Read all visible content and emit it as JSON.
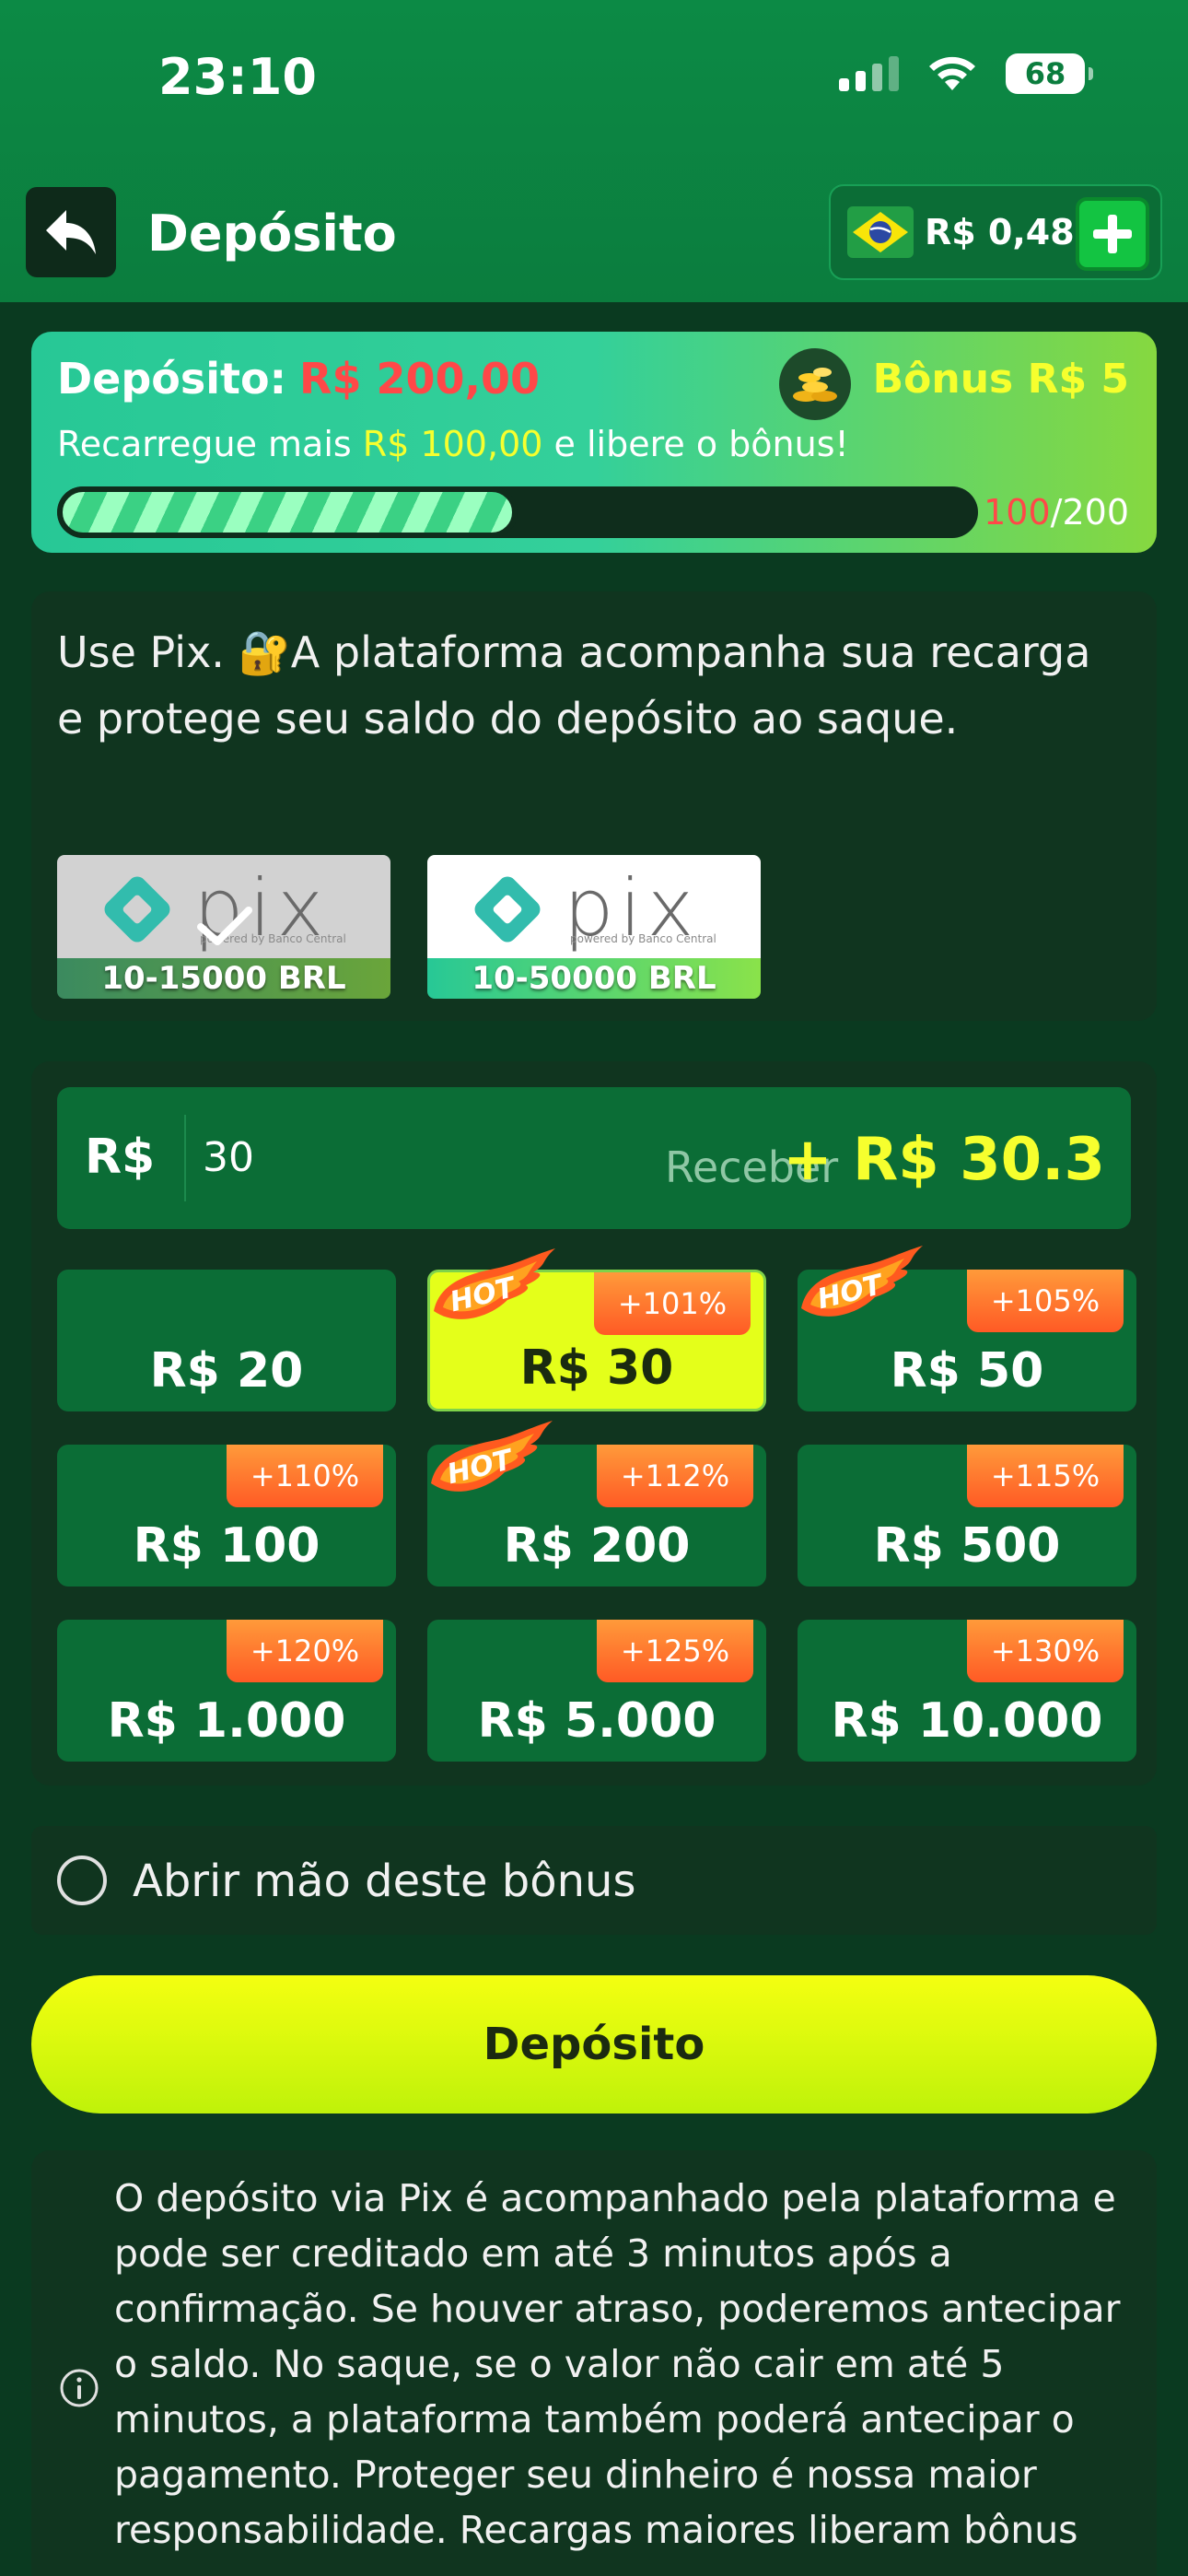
{
  "status_bar": {
    "time": "23:10",
    "battery": "68"
  },
  "header": {
    "title": "Depósito",
    "balance": "R$ 0,48"
  },
  "bonus_card": {
    "deposit_label": "Depósito:",
    "deposit_value": "R$ 200,00",
    "bonus": "Bônus R$ 5",
    "hint_prefix": "Recarregue mais",
    "hint_amount": "R$ 100,00",
    "hint_suffix": "e libere o bônus!",
    "progress_current": "100",
    "progress_total": "/200",
    "progress_fraction": 0.5
  },
  "pix_panel": {
    "text": "Use Pix. 🔐A plataforma acompanha sua recarga e protege seu saldo do depósito ao saque.",
    "options": [
      {
        "logo_text": "pix",
        "logo_sub": "powered by Banco Central",
        "range": "10-15000 BRL",
        "selected": true
      },
      {
        "logo_text": "pix",
        "logo_sub": "powered by Banco Central",
        "range": "10-50000 BRL",
        "selected": false
      }
    ]
  },
  "amount_panel": {
    "currency": "R$",
    "input_value": "30",
    "receive_label": "Receber",
    "receive_value": "+ R$ 30.3",
    "hot_label": "HOT",
    "options": [
      {
        "label": "R$ 20",
        "badge": "",
        "hot": false,
        "selected": false
      },
      {
        "label": "R$ 30",
        "badge": "+101%",
        "hot": true,
        "selected": true
      },
      {
        "label": "R$ 50",
        "badge": "+105%",
        "hot": true,
        "selected": false
      },
      {
        "label": "R$ 100",
        "badge": "+110%",
        "hot": false,
        "selected": false
      },
      {
        "label": "R$ 200",
        "badge": "+112%",
        "hot": true,
        "selected": false
      },
      {
        "label": "R$ 500",
        "badge": "+115%",
        "hot": false,
        "selected": false
      },
      {
        "label": "R$ 1.000",
        "badge": "+120%",
        "hot": false,
        "selected": false
      },
      {
        "label": "R$ 5.000",
        "badge": "+125%",
        "hot": false,
        "selected": false
      },
      {
        "label": "R$ 10.000",
        "badge": "+130%",
        "hot": false,
        "selected": false
      }
    ]
  },
  "forfeit": {
    "label": "Abrir mão deste bônus",
    "checked": false
  },
  "deposit_button": {
    "label": "Depósito"
  },
  "info": {
    "text": "O depósito via Pix é acompanhado pela plataforma e pode ser creditado em até 3 minutos após a confirmação. Se houver atraso, poderemos antecipar o saldo. No saque, se o valor não cair em até 5 minutos, a plataforma também poderá antecipar o pagamento. Proteger seu dinheiro é nossa maior responsabilidade. Recargas maiores liberam bônus"
  },
  "colors": {
    "header_green": "#0b7d3e",
    "page_bg": "#0a3a20",
    "panel_bg": "#10351f",
    "option_bg": "#0b6d36",
    "accent_yellow": "#f6ff2e",
    "alert_red": "#ff4848",
    "badge_orange": "#ff6a2a"
  },
  "icons": {
    "back": "back-arrow-icon",
    "flag": "brazil-flag-icon",
    "add": "plus-icon",
    "coins": "gold-coins-icon",
    "check": "check-icon",
    "hot": "hot-flame-icon",
    "info": "info-icon"
  }
}
